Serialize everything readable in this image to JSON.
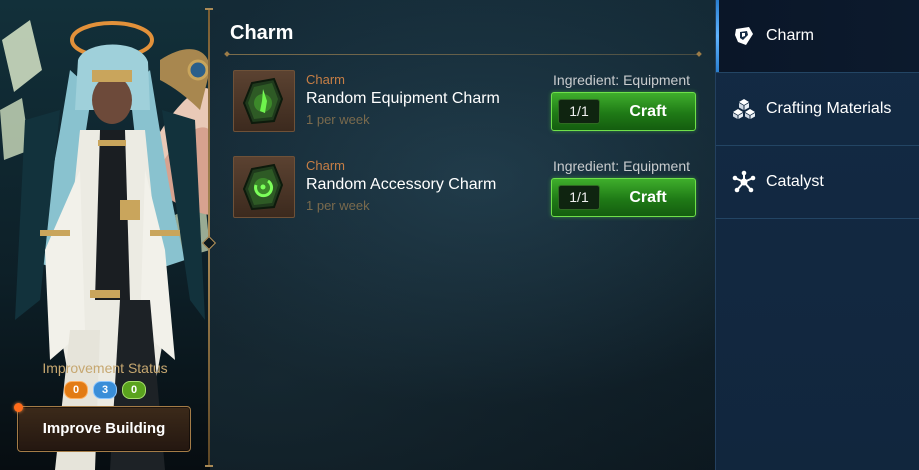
{
  "left_panel": {
    "improvement_status_label": "Improvement Status",
    "status_counts": [
      "0",
      "3",
      "0"
    ],
    "improve_button_label": "Improve Building"
  },
  "main": {
    "section_title": "Charm",
    "recipes": [
      {
        "category": "Charm",
        "name": "Random Equipment Charm",
        "limit": "1 per week",
        "ingredient": "Ingredient: Equipment",
        "count": "1/1",
        "craft_label": "Craft",
        "icon": "equipment-charm-icon"
      },
      {
        "category": "Charm",
        "name": "Random Accessory Charm",
        "limit": "1 per week",
        "ingredient": "Ingredient: Equipment",
        "count": "1/1",
        "craft_label": "Craft",
        "icon": "accessory-charm-icon"
      }
    ]
  },
  "tabs": [
    {
      "label": "Charm",
      "icon": "charm-icon",
      "active": true
    },
    {
      "label": "Crafting Materials",
      "icon": "crafting-materials-icon",
      "active": false
    },
    {
      "label": "Catalyst",
      "icon": "catalyst-icon",
      "active": false
    }
  ],
  "colors": {
    "accent_gold": "#c6a770",
    "craft_green": "#3fae2c",
    "category_orange": "#c67e45",
    "tab_blue": "#132a44"
  }
}
